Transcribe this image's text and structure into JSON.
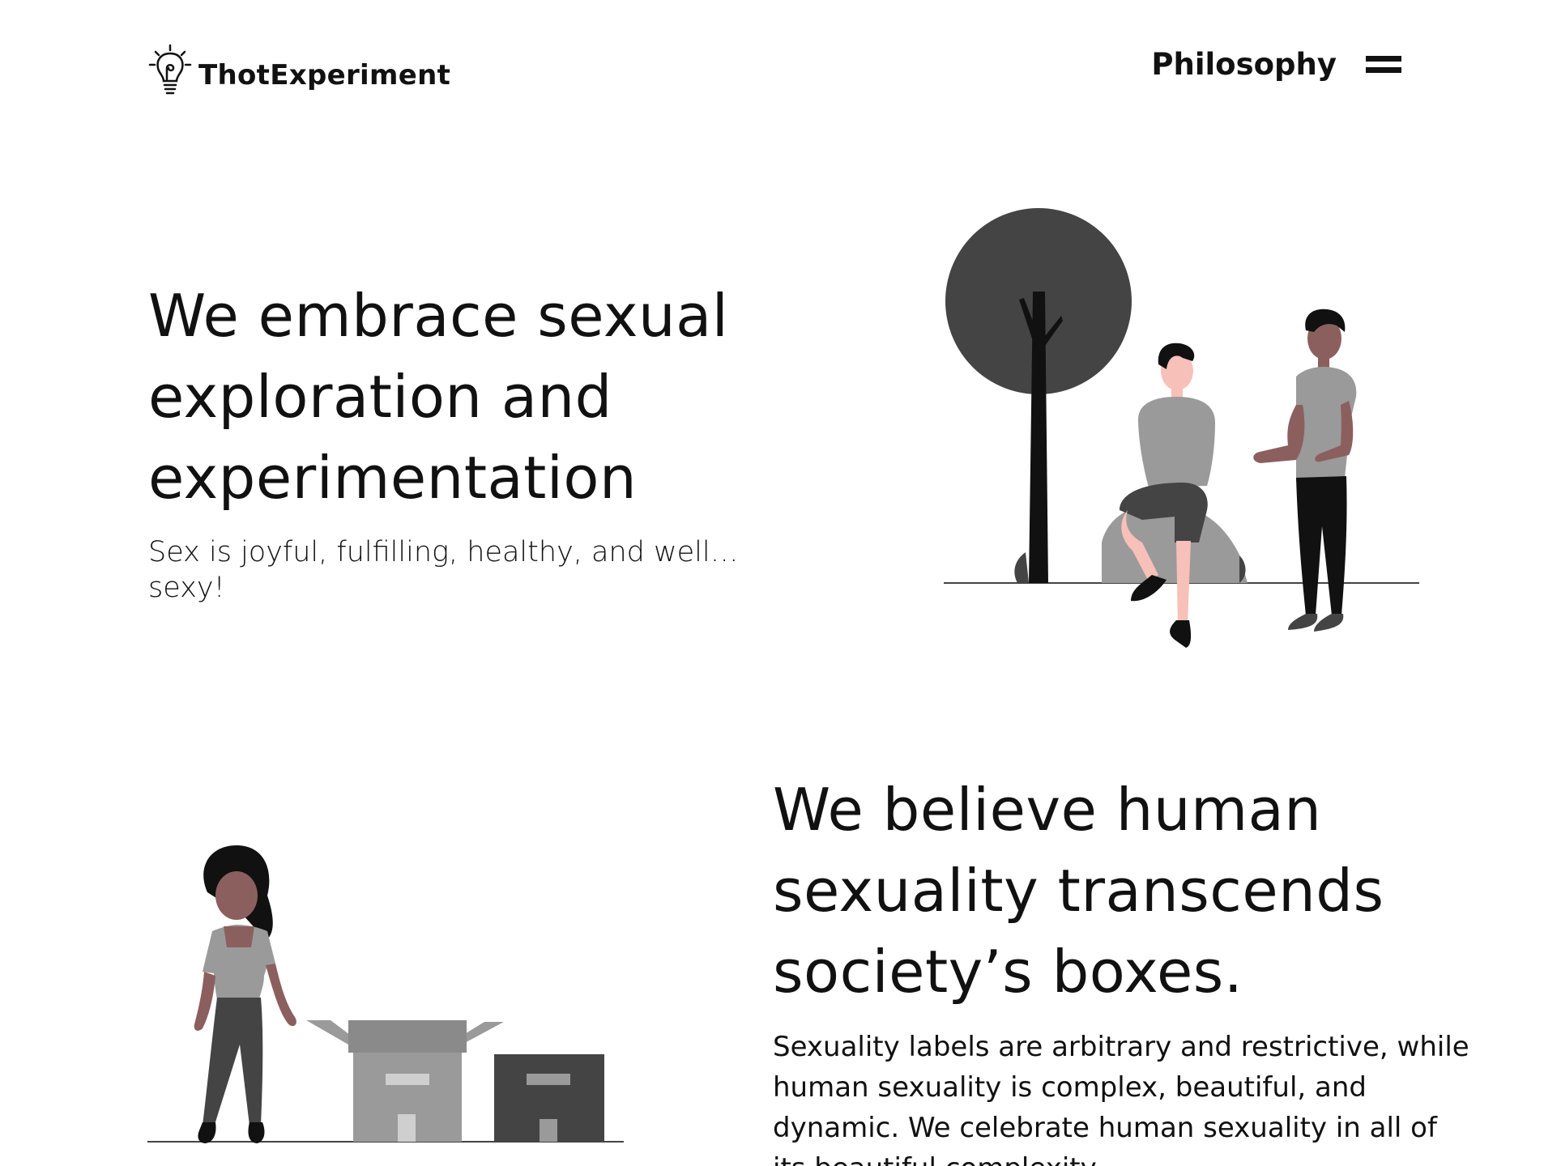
{
  "header": {
    "brand": "ThotExperiment",
    "logo_icon": "lightbulb-icon",
    "nav_link": "Philosophy",
    "menu_icon": "hamburger-menu-icon"
  },
  "hero": {
    "title": "We embrace sexual exploration and experimentation",
    "subtitle": "Sex is joyful, fulfilling, healthy, and well… sexy!"
  },
  "beliefs": {
    "title": "We believe human sexuality transcends society’s boxes.",
    "body": "Sexuality labels are arbitrary and restrictive, while human sexuality is complex, beautiful, and dynamic.  We celebrate human sexuality in all of its beautiful complexity."
  },
  "colors": {
    "text": "#111111",
    "dark_gray": "#444444",
    "mid_gray": "#9a9a9a",
    "skin_light": "#f7c0b8",
    "skin_dark": "#8c5f5f"
  }
}
